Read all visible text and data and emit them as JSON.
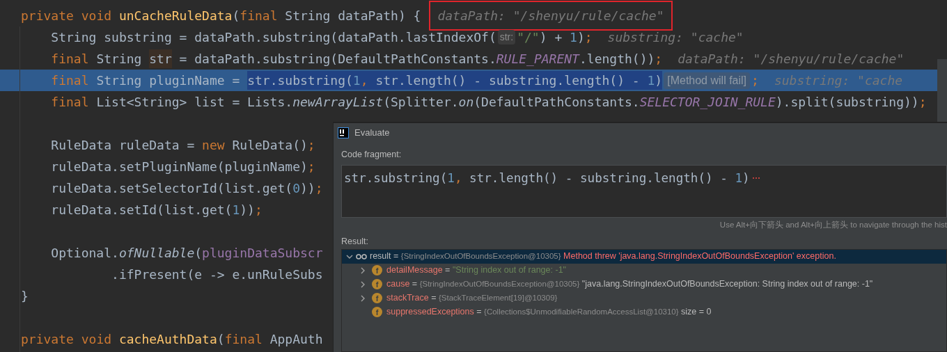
{
  "editor": {
    "blocks": [
      {
        "lines": [
          {
            "current": false,
            "tokens": [
              {
                "text": "private ",
                "kind": "keyword"
              },
              {
                "text": "void ",
                "kind": "keyword"
              },
              {
                "text": "unCacheRuleData",
                "kind": "declaration"
              },
              {
                "text": "(",
                "kind": "plain"
              },
              {
                "text": "final ",
                "kind": "keyword"
              },
              {
                "text": "String dataPath) {",
                "kind": "plain"
              }
            ],
            "hints": [
              {
                "text": "dataPath: \"/shenyu/rule/cache\"",
                "outlined": true
              }
            ]
          },
          {
            "current": false,
            "tokens": [
              {
                "text": "    String substring = dataPath.substring(dataPath.lastIndexOf(",
                "kind": "plain"
              },
              {
                "text": "str:",
                "kind": "parameter_hint"
              },
              {
                "text": "\"/\"",
                "kind": "string"
              },
              {
                "text": ") + ",
                "kind": "plain"
              },
              {
                "text": "1",
                "kind": "number"
              },
              {
                "text": ")",
                "kind": "plain"
              },
              {
                "text": ";",
                "kind": "keyword"
              }
            ],
            "hints": [
              {
                "text": "substring: \"cache\"",
                "outlined": false
              }
            ]
          },
          {
            "current": false,
            "tokens": [
              {
                "text": "    final ",
                "kind": "keyword"
              },
              {
                "text": "String ",
                "kind": "plain"
              },
              {
                "text": "str",
                "kind": "usage"
              },
              {
                "text": " = dataPath.substring(DefaultPathConstants.",
                "kind": "plain"
              },
              {
                "text": "RULE_PARENT",
                "kind": "constant"
              },
              {
                "text": ".length())",
                "kind": "plain"
              },
              {
                "text": ";",
                "kind": "keyword"
              }
            ],
            "hints": [
              {
                "text": "dataPath: \"/shenyu/rule/cache\"",
                "outlined": false
              }
            ]
          },
          {
            "current": true,
            "tokens": [
              {
                "text": "    final ",
                "kind": "keyword"
              },
              {
                "text": "String pluginName = ",
                "kind": "plain"
              }
            ],
            "selection": [
              {
                "text": "str.substring(",
                "kind": "plain"
              },
              {
                "text": "1",
                "kind": "number"
              },
              {
                "text": ", ",
                "kind": "keyword"
              },
              {
                "text": "str.length() - substring.length() - ",
                "kind": "plain"
              },
              {
                "text": "1",
                "kind": "number"
              },
              {
                "text": ")",
                "kind": "plain"
              }
            ],
            "after": [
              {
                "text": "[Method will fail]",
                "kind": "failure_hint"
              },
              {
                "text": ";",
                "kind": "keyword"
              }
            ],
            "hints": [
              {
                "text": "substring: \"cache",
                "outlined": false
              }
            ]
          },
          {
            "current": false,
            "tokens": [
              {
                "text": "    final ",
                "kind": "keyword"
              },
              {
                "text": "List<String> list = Lists.",
                "kind": "plain"
              },
              {
                "text": "newArrayList",
                "kind": "static"
              },
              {
                "text": "(Splitter.",
                "kind": "plain"
              },
              {
                "text": "on",
                "kind": "static"
              },
              {
                "text": "(DefaultPathConstants.",
                "kind": "plain"
              },
              {
                "text": "SELECTOR_JOIN_RULE",
                "kind": "constant"
              },
              {
                "text": ").split(substring))",
                "kind": "plain"
              },
              {
                "text": ";",
                "kind": "keyword"
              }
            ]
          }
        ]
      },
      {
        "lines": [
          {
            "current": false,
            "tokens": [
              {
                "text": "    RuleData ruleData = ",
                "kind": "plain"
              },
              {
                "text": "new ",
                "kind": "keyword"
              },
              {
                "text": "RuleData()",
                "kind": "plain"
              },
              {
                "text": ";",
                "kind": "keyword"
              }
            ]
          },
          {
            "current": false,
            "tokens": [
              {
                "text": "    ruleData.setPluginName(pluginName)",
                "kind": "plain"
              },
              {
                "text": ";",
                "kind": "keyword"
              }
            ]
          },
          {
            "current": false,
            "tokens": [
              {
                "text": "    ruleData.setSelectorId(list.get(",
                "kind": "plain"
              },
              {
                "text": "0",
                "kind": "number"
              },
              {
                "text": "))",
                "kind": "plain"
              },
              {
                "text": ";",
                "kind": "keyword"
              }
            ]
          },
          {
            "current": false,
            "tokens": [
              {
                "text": "    ruleData.setId(list.get(",
                "kind": "plain"
              },
              {
                "text": "1",
                "kind": "number"
              },
              {
                "text": "))",
                "kind": "plain"
              },
              {
                "text": ";",
                "kind": "keyword"
              }
            ]
          }
        ]
      },
      {
        "lines": [
          {
            "current": false,
            "tokens": [
              {
                "text": "    Optional.",
                "kind": "plain"
              },
              {
                "text": "ofNullable",
                "kind": "static"
              },
              {
                "text": "(",
                "kind": "plain"
              },
              {
                "text": "pluginDataSubscr",
                "kind": "field"
              }
            ]
          },
          {
            "current": false,
            "tokens": [
              {
                "text": "            .ifPresent(e -> e.unRuleSubs",
                "kind": "plain"
              }
            ]
          },
          {
            "current": false,
            "tokens": [
              {
                "text": "}",
                "kind": "plain"
              }
            ]
          }
        ]
      },
      {
        "lines": [
          {
            "current": false,
            "tokens": [
              {
                "text": "private ",
                "kind": "keyword"
              },
              {
                "text": "void ",
                "kind": "keyword"
              },
              {
                "text": "cacheAuthData",
                "kind": "declaration"
              },
              {
                "text": "(",
                "kind": "plain"
              },
              {
                "text": "final ",
                "kind": "keyword"
              },
              {
                "text": "AppAuth",
                "kind": "plain"
              }
            ]
          }
        ]
      }
    ]
  },
  "evaluate_dialog": {
    "title": "Evaluate",
    "code_label": "Code fragment:",
    "code_tokens": [
      {
        "text": "str.substring(",
        "kind": "plain"
      },
      {
        "text": "1",
        "kind": "number"
      },
      {
        "text": ", ",
        "kind": "keyword"
      },
      {
        "text": "str.length() - substring.length() - ",
        "kind": "plain"
      },
      {
        "text": "1",
        "kind": "number"
      },
      {
        "text": ")",
        "kind": "plain"
      }
    ],
    "history_hint": "Use Alt+向下箭头 and Alt+向上箭头 to navigate through the hist",
    "result_label": "Result:",
    "result": {
      "name": "result",
      "operator": "=",
      "type": "{StringIndexOutOfBoundsException@10305}",
      "message": "Method threw 'java.lang.StringIndexOutOfBoundsException' exception.",
      "expanded": true,
      "selected": true,
      "children": [
        {
          "badge": "f",
          "name": "detailMessage",
          "operator": "=",
          "value": "\"String index out of range: -1\"",
          "expandable": true
        },
        {
          "badge": "f",
          "name": "cause",
          "operator": "=",
          "type": "{StringIndexOutOfBoundsException@10305}",
          "description": "\"java.lang.StringIndexOutOfBoundsException: String index out of range: -1\"",
          "expandable": true
        },
        {
          "badge": "f",
          "name": "stackTrace",
          "operator": "=",
          "type": "{StackTraceElement[19]@10309}",
          "expandable": true
        },
        {
          "badge": "f",
          "name": "suppressedExceptions",
          "operator": "=",
          "type": "{Collections$UnmodifiableRandomAccessList@10310}",
          "description": "size = 0",
          "expandable": false
        }
      ]
    }
  }
}
